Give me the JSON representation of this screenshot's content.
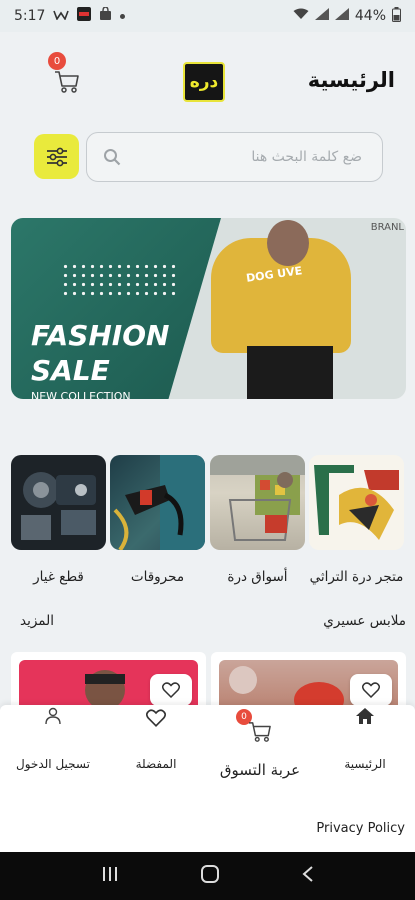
{
  "status_bar": {
    "time": "5:17",
    "battery": "44%",
    "icons": [
      "notification-icon",
      "app-icon",
      "shopping-bag-icon",
      "dot-icon",
      "wifi-icon",
      "signal-icon",
      "signal-icon",
      "battery-icon"
    ]
  },
  "header": {
    "title": "الرئيسية",
    "logo_text": "دره",
    "cart_badge": "0"
  },
  "search": {
    "placeholder": "ضع كلمة البحث هنا"
  },
  "banner": {
    "headline_line1": "FASHION",
    "headline_line2": "SALE",
    "subline": "NEW COLLECTION",
    "brand": "BRANL",
    "shirt_text": "DOG UVE"
  },
  "categories": [
    {
      "label": "متجر درة التراثي",
      "icon": "heritage-store-image"
    },
    {
      "label": "أسواق درة",
      "icon": "supermarket-image"
    },
    {
      "label": "محروقات",
      "icon": "fuel-image"
    },
    {
      "label": "قطع غيار",
      "icon": "auto-parts-image"
    }
  ],
  "section": {
    "title": "ملابس عسيري",
    "more": "المزيد"
  },
  "bottom_nav": {
    "home": "الرئيسية",
    "cart": "عربة التسوق",
    "cart_badge": "0",
    "favorites": "المفضلة",
    "login": "تسجيل الدخول"
  },
  "footer": {
    "privacy": "Privacy Policy"
  },
  "colors": {
    "accent_yellow": "#e9ea3c",
    "badge_red": "#e84c3d",
    "banner_green": "#2c7769"
  }
}
